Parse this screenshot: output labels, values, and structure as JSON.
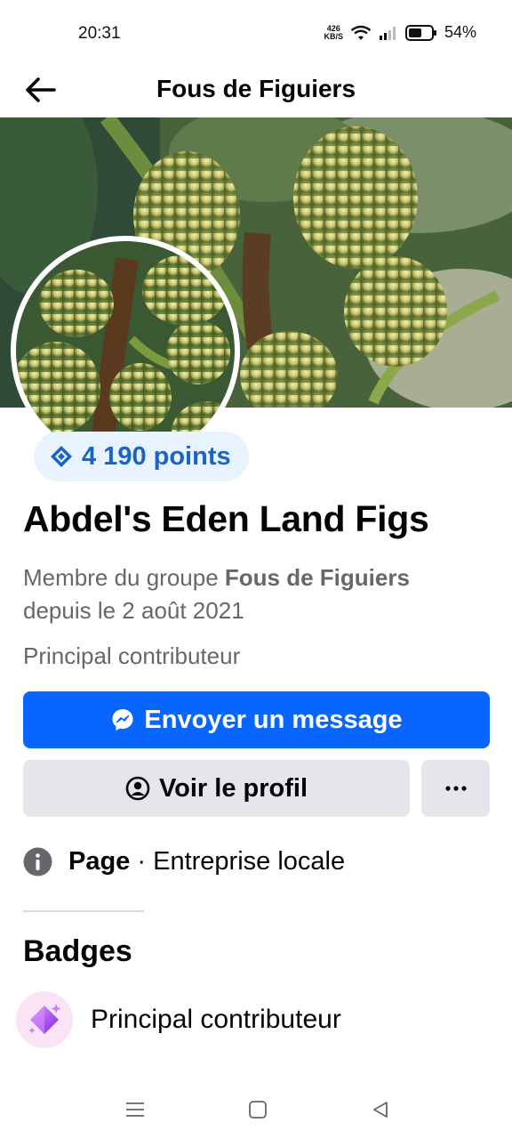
{
  "status_bar": {
    "time": "20:31",
    "net_speed_value": "426",
    "net_speed_unit": "KB/S",
    "battery_percent": "54%",
    "icons": [
      "wifi-icon",
      "signal-icon",
      "battery-icon"
    ]
  },
  "header": {
    "title": "Fous de Figuiers",
    "back_icon": "arrow-left-icon"
  },
  "profile": {
    "points": "4 190 points",
    "name": "Abdel's Eden Land Figs",
    "member_prefix": "Membre du groupe ",
    "group_name": "Fous de Figuiers",
    "member_since": "depuis le 2 août 2021",
    "role": "Principal contributeur"
  },
  "actions": {
    "message_label": "Envoyer un message",
    "profile_label": "Voir le profil",
    "more_icon": "more-dots-icon"
  },
  "page_info": {
    "type_label": "Page",
    "separator": " · ",
    "category": "Entreprise locale"
  },
  "badges": {
    "title": "Badges",
    "items": [
      {
        "label": "Principal contributeur",
        "icon": "sparkle-diamond-icon"
      }
    ]
  },
  "colors": {
    "accent": "#0866ff",
    "points_text": "#1b63c7",
    "points_bg": "#e7f3ff",
    "secondary_text": "#65676b",
    "secondary_button": "#e4e6eb"
  }
}
